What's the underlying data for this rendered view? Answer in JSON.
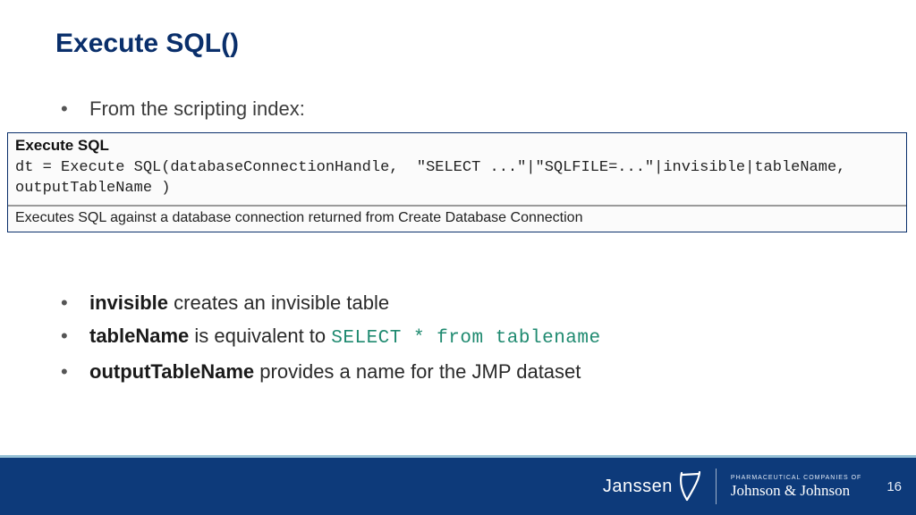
{
  "title": "Execute SQL()",
  "intro_bullet": "From the scripting index:",
  "docbox": {
    "heading": "Execute SQL",
    "code": "dt = Execute SQL(databaseConnectionHandle,  \"SELECT ...\"|\"SQLFILE=...\"|invisible|tableName, outputTableName )",
    "description": "Executes SQL against a database connection returned from Create Database Connection"
  },
  "bullets": [
    {
      "term": "invisible",
      "rest": " creates an invisible table"
    },
    {
      "term": "tableName",
      "rest": " is equivalent to ",
      "code": "SELECT * from tablename"
    },
    {
      "term": "outputTableName",
      "rest": " provides a name for the JMP dataset"
    }
  ],
  "footer": {
    "janssen": "Janssen",
    "jnj_small": "pharmaceutical companies of",
    "jnj_script": "Johnson & Johnson",
    "page": "16"
  }
}
